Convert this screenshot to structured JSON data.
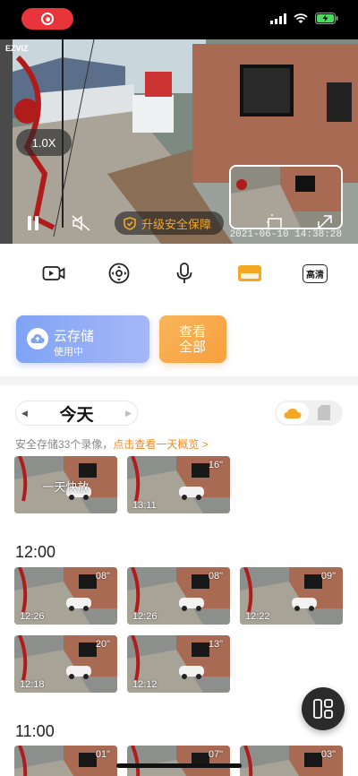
{
  "status_bar": {
    "record_icon": "record-icon",
    "signal_icon": "signal-icon",
    "wifi_icon": "wifi-icon",
    "battery_icon": "battery-charging-icon"
  },
  "video": {
    "brand": "EZVIZ",
    "zoom": "1.0X",
    "upgrade_label": "升级安全保障",
    "timestamp": "2021-06-10  14:38:28",
    "pause_icon": "pause-icon",
    "mute_icon": "mute-icon",
    "shield_icon": "shield-icon",
    "accent": "#f5a623"
  },
  "toolbar": {
    "record_icon": "video-record-icon",
    "ptz_icon": "ptz-control-icon",
    "mic_icon": "microphone-icon",
    "window_icon": "window-icon",
    "quality_label": "高清"
  },
  "cloud_card": {
    "title": "云存储",
    "subtitle": "使用中"
  },
  "view_card": {
    "line1": "查看",
    "line2": "全部"
  },
  "date": {
    "label": "今天"
  },
  "info": {
    "prefix": "安全存储33个录像，",
    "link": "点击查看一天概览 >"
  },
  "clips": {
    "first": {
      "label": "一天快放"
    },
    "second": {
      "duration": "16\"",
      "time": "13:11"
    },
    "hour1": "12:00",
    "hour1_items": [
      {
        "duration": "08\"",
        "time": "12:26"
      },
      {
        "duration": "08\"",
        "time": "12:26"
      },
      {
        "duration": "09\"",
        "time": "12:22"
      },
      {
        "duration": "20\"",
        "time": "12:18"
      },
      {
        "duration": "13\"",
        "time": "12:12"
      }
    ],
    "hour2": "11:00",
    "hour2_items": [
      {
        "duration": "01\""
      },
      {
        "duration": "07\""
      },
      {
        "duration": "03\""
      }
    ]
  },
  "fab": {
    "icon": "layout-toggle-icon"
  }
}
